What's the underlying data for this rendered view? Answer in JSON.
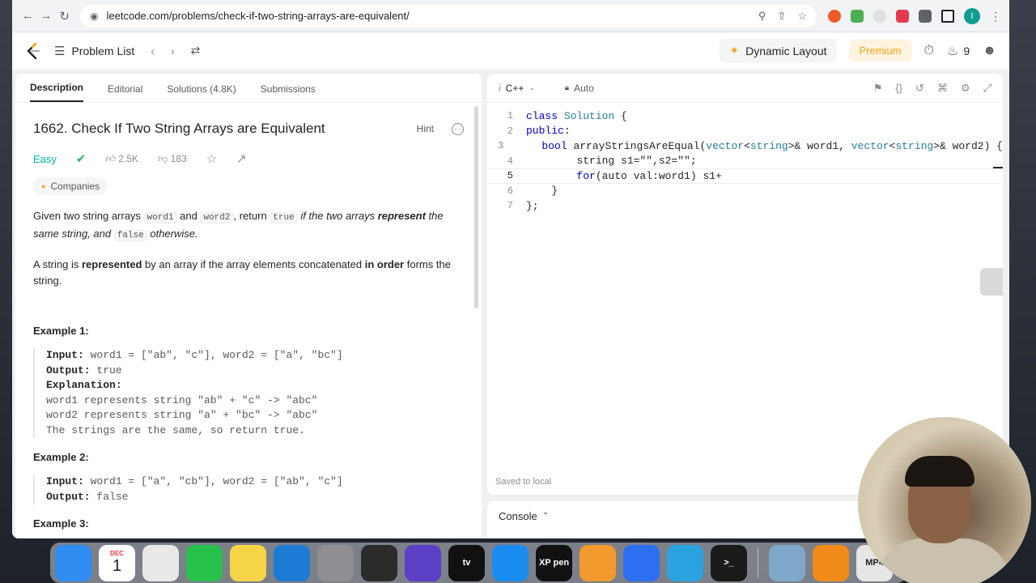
{
  "browser": {
    "url": "leetcode.com/problems/check-if-two-string-arrays-are-equivalent/",
    "profile_initial": "I"
  },
  "nav": {
    "problem_list": "Problem List",
    "dynamic_layout": "Dynamic Layout",
    "premium": "Premium",
    "streak": "9"
  },
  "tabs": [
    "Description",
    "Editorial",
    "Solutions (4.8K)",
    "Submissions"
  ],
  "problem": {
    "title": "1662. Check If Two String Arrays are Equivalent",
    "hint": "Hint",
    "difficulty": "Easy",
    "likes": "2.5K",
    "dislikes": "183",
    "companies": "Companies",
    "desc1": {
      "a": "Given two string arrays ",
      "b": "word1",
      "c": " and ",
      "d": "word2",
      "e": ", return ",
      "f": "true",
      "g": " if the two arrays ",
      "h": "represent",
      "i": " the same string, and ",
      "j": "false",
      "k": " otherwise."
    },
    "desc2": {
      "a": "A string is ",
      "b": "represented",
      "c": " by an array if the array elements concatenated ",
      "d": "in order",
      "e": " forms the string."
    },
    "examples": [
      {
        "title": "Example 1:",
        "input_label": "Input:",
        "input": " word1 = [\"ab\", \"c\"], word2 = [\"a\", \"bc\"]",
        "output_label": "Output:",
        "output": " true",
        "explanation_label": "Explanation:",
        "explanation": [
          "word1 represents string \"ab\" + \"c\" -> \"abc\"",
          "word2 represents string \"a\" + \"bc\" -> \"abc\"",
          "The strings are the same, so return true."
        ]
      },
      {
        "title": "Example 2:",
        "input_label": "Input:",
        "input": " word1 = [\"a\", \"cb\"], word2 = [\"ab\", \"c\"]",
        "output_label": "Output:",
        "output": " false"
      },
      {
        "title": "Example 3:"
      }
    ]
  },
  "editor": {
    "language": "C++",
    "lang_prefix": "i",
    "mode": "Auto",
    "saved": "Saved to local",
    "lines": [
      {
        "n": "1",
        "parts": [
          [
            "kw",
            "class"
          ],
          [
            "tx",
            " "
          ],
          [
            "ty",
            "Solution"
          ],
          [
            "tx",
            " {"
          ]
        ]
      },
      {
        "n": "2",
        "parts": [
          [
            "kw",
            "public"
          ],
          [
            "tx",
            ":"
          ]
        ]
      },
      {
        "n": "3",
        "parts": [
          [
            "tx",
            "    "
          ],
          [
            "kw",
            "bool"
          ],
          [
            "tx",
            " arrayStringsAreEqual("
          ],
          [
            "ty",
            "vector"
          ],
          [
            "tx",
            "<"
          ],
          [
            "ty",
            "string"
          ],
          [
            "tx",
            ">& word1, "
          ],
          [
            "ty",
            "vector"
          ],
          [
            "tx",
            "<"
          ],
          [
            "ty",
            "string"
          ],
          [
            "tx",
            ">& word2) {"
          ]
        ]
      },
      {
        "n": "4",
        "parts": [
          [
            "tx",
            "        string s1=\"\",s2=\"\";"
          ]
        ]
      },
      {
        "n": "5",
        "parts": [
          [
            "tx",
            "        "
          ],
          [
            "kw",
            "for"
          ],
          [
            "tx",
            "(auto val:word1) s1+"
          ]
        ]
      },
      {
        "n": "6",
        "parts": [
          [
            "tx",
            "    }"
          ]
        ]
      },
      {
        "n": "7",
        "parts": [
          [
            "tx",
            "};"
          ]
        ]
      }
    ],
    "current_line": "5"
  },
  "console": {
    "label": "Console"
  },
  "dock": {
    "apps": [
      {
        "name": "finder-app",
        "color": "#2f8cf0",
        "label": ""
      },
      {
        "name": "calendar-app",
        "color": "#ffffff",
        "label": "1",
        "sub": "DEC"
      },
      {
        "name": "chrome-app",
        "color": "#e8e8e8",
        "label": ""
      },
      {
        "name": "facetime-app",
        "color": "#27c24c",
        "label": ""
      },
      {
        "name": "notes-app",
        "color": "#f5d547",
        "label": ""
      },
      {
        "name": "vscode-app",
        "color": "#1e7bd3",
        "label": ""
      },
      {
        "name": "settings-app",
        "color": "#8e8e93",
        "label": ""
      },
      {
        "name": "obs-app",
        "color": "#2b2b2b",
        "label": ""
      },
      {
        "name": "imovie-app",
        "color": "#5b3fc4",
        "label": ""
      },
      {
        "name": "appletv-app",
        "color": "#111111",
        "label": "tv"
      },
      {
        "name": "appstore-app",
        "color": "#1a8cf0",
        "label": ""
      },
      {
        "name": "xppen-app",
        "color": "#111111",
        "label": "XP pen"
      },
      {
        "name": "pages-app",
        "color": "#f29a2e",
        "label": ""
      },
      {
        "name": "sketch-app",
        "color": "#2d6ff0",
        "label": ""
      },
      {
        "name": "telegram-app",
        "color": "#2aa3e0",
        "label": ""
      },
      {
        "name": "terminal-app",
        "color": "#1a1a1a",
        "label": ">_"
      },
      {
        "name": "preview-app",
        "color": "#7fa7c9",
        "label": ""
      },
      {
        "name": "vlc-app",
        "color": "#f08b1a",
        "label": ""
      },
      {
        "name": "mp4-file",
        "color": "#e6e6e6",
        "label": "MP4"
      }
    ]
  },
  "colors": {
    "accent": "#ffa116",
    "easy": "#00b8a3",
    "keyword": "#0000cc",
    "type": "#267f99"
  }
}
